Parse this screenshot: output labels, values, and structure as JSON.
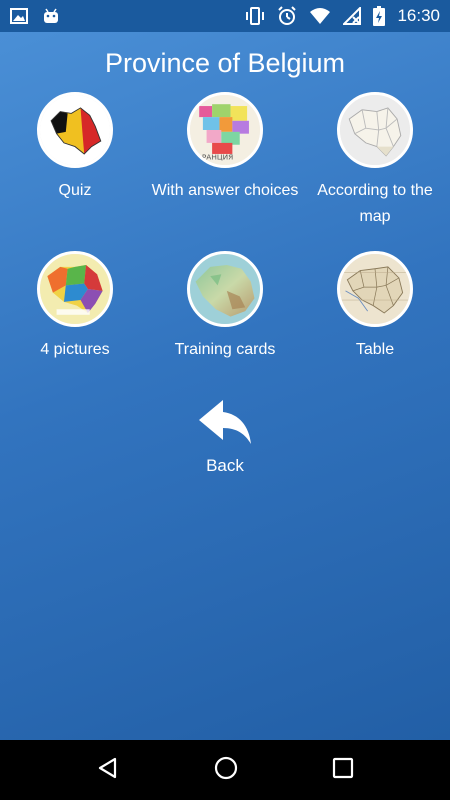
{
  "status_bar": {
    "time": "16:30",
    "icons": [
      "image-icon",
      "android-icon",
      "vibrate-icon",
      "alarm-icon",
      "wifi-icon",
      "signal-icon",
      "battery-icon"
    ]
  },
  "app": {
    "title": "Province of Belgium",
    "menu": [
      {
        "label": "Quiz",
        "icon": "belgium-flag-map-icon"
      },
      {
        "label": "With answer choices",
        "icon": "provinces-map-icon"
      },
      {
        "label": "According to the map",
        "icon": "outline-map-icon"
      },
      {
        "label": "4 pictures",
        "icon": "colored-map-icon"
      },
      {
        "label": "Training cards",
        "icon": "relief-map-icon"
      },
      {
        "label": "Table",
        "icon": "old-map-icon"
      }
    ],
    "back_label": "Back"
  },
  "nav": {
    "icons": [
      "back-triangle-icon",
      "home-circle-icon",
      "recents-square-icon"
    ]
  },
  "colors": {
    "background_top": "#4a8fd6",
    "background_bottom": "#225fa6",
    "text": "#ffffff"
  }
}
